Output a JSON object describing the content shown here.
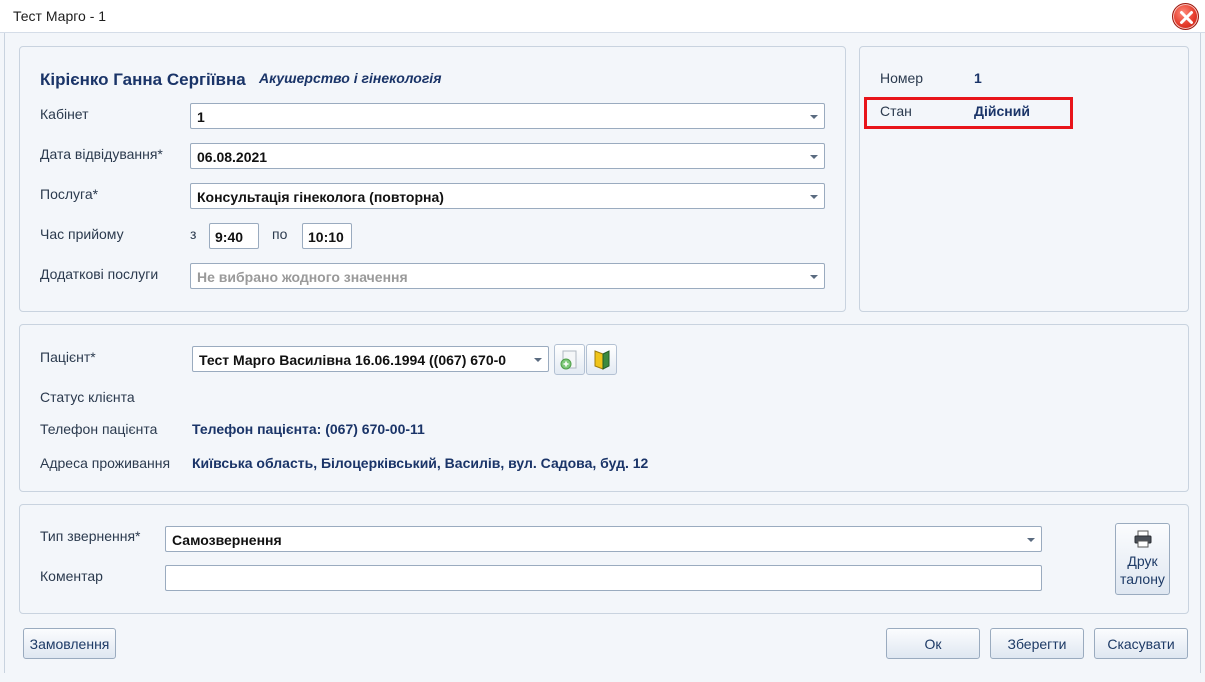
{
  "window": {
    "title": "Тест Марго - 1"
  },
  "appointment": {
    "doctor_name": "Кірієнко Ганна Сергіївна",
    "specialty": "Акушерство і гінекологія",
    "cabinet_label": "Кабінет",
    "cabinet_value": "1",
    "date_label": "Дата відвідування*",
    "date_value": "06.08.2021",
    "service_label": "Послуга*",
    "service_value": "Консультація гінеколога (повторна)",
    "time_label": "Час прийому",
    "time_from_label": "з",
    "time_from": "9:40",
    "time_to_label": "по",
    "time_to": "10:10",
    "extra_label": "Додаткові послуги",
    "extra_placeholder": "Не вибрано жодного значення"
  },
  "info": {
    "number_label": "Номер",
    "number_value": "1",
    "state_label": "Стан",
    "state_value": "Дійсний",
    "highlight_color": "#e8141a"
  },
  "patient": {
    "patient_label": "Пацієнт*",
    "patient_value": "Тест Марго Василівна 16.06.1994 ((067) 670-0",
    "status_label": "Статус клієнта",
    "phone_label": "Телефон пацієнта",
    "phone_value": "Телефон пацієнта: (067) 670-00-11",
    "address_label": "Адреса проживання",
    "address_value": "Київська область, Білоцерківський, Василів, вул. Садова, буд. 12",
    "icons": [
      "add-document-icon",
      "book-icon"
    ]
  },
  "request": {
    "type_label": "Тип звернення*",
    "type_value": "Самозвернення",
    "comment_label": "Коментар",
    "comment_value": "",
    "print_label_line1": "Друк",
    "print_label_line2": "талону"
  },
  "footer": {
    "orders_label": "Замовлення",
    "ok_label": "Ок",
    "save_label": "Зберегти",
    "cancel_label": "Скасувати"
  },
  "colors": {
    "accent_text": "#1a3468",
    "panel_bg": "#f3f6fa",
    "border": "#c9d3df"
  }
}
